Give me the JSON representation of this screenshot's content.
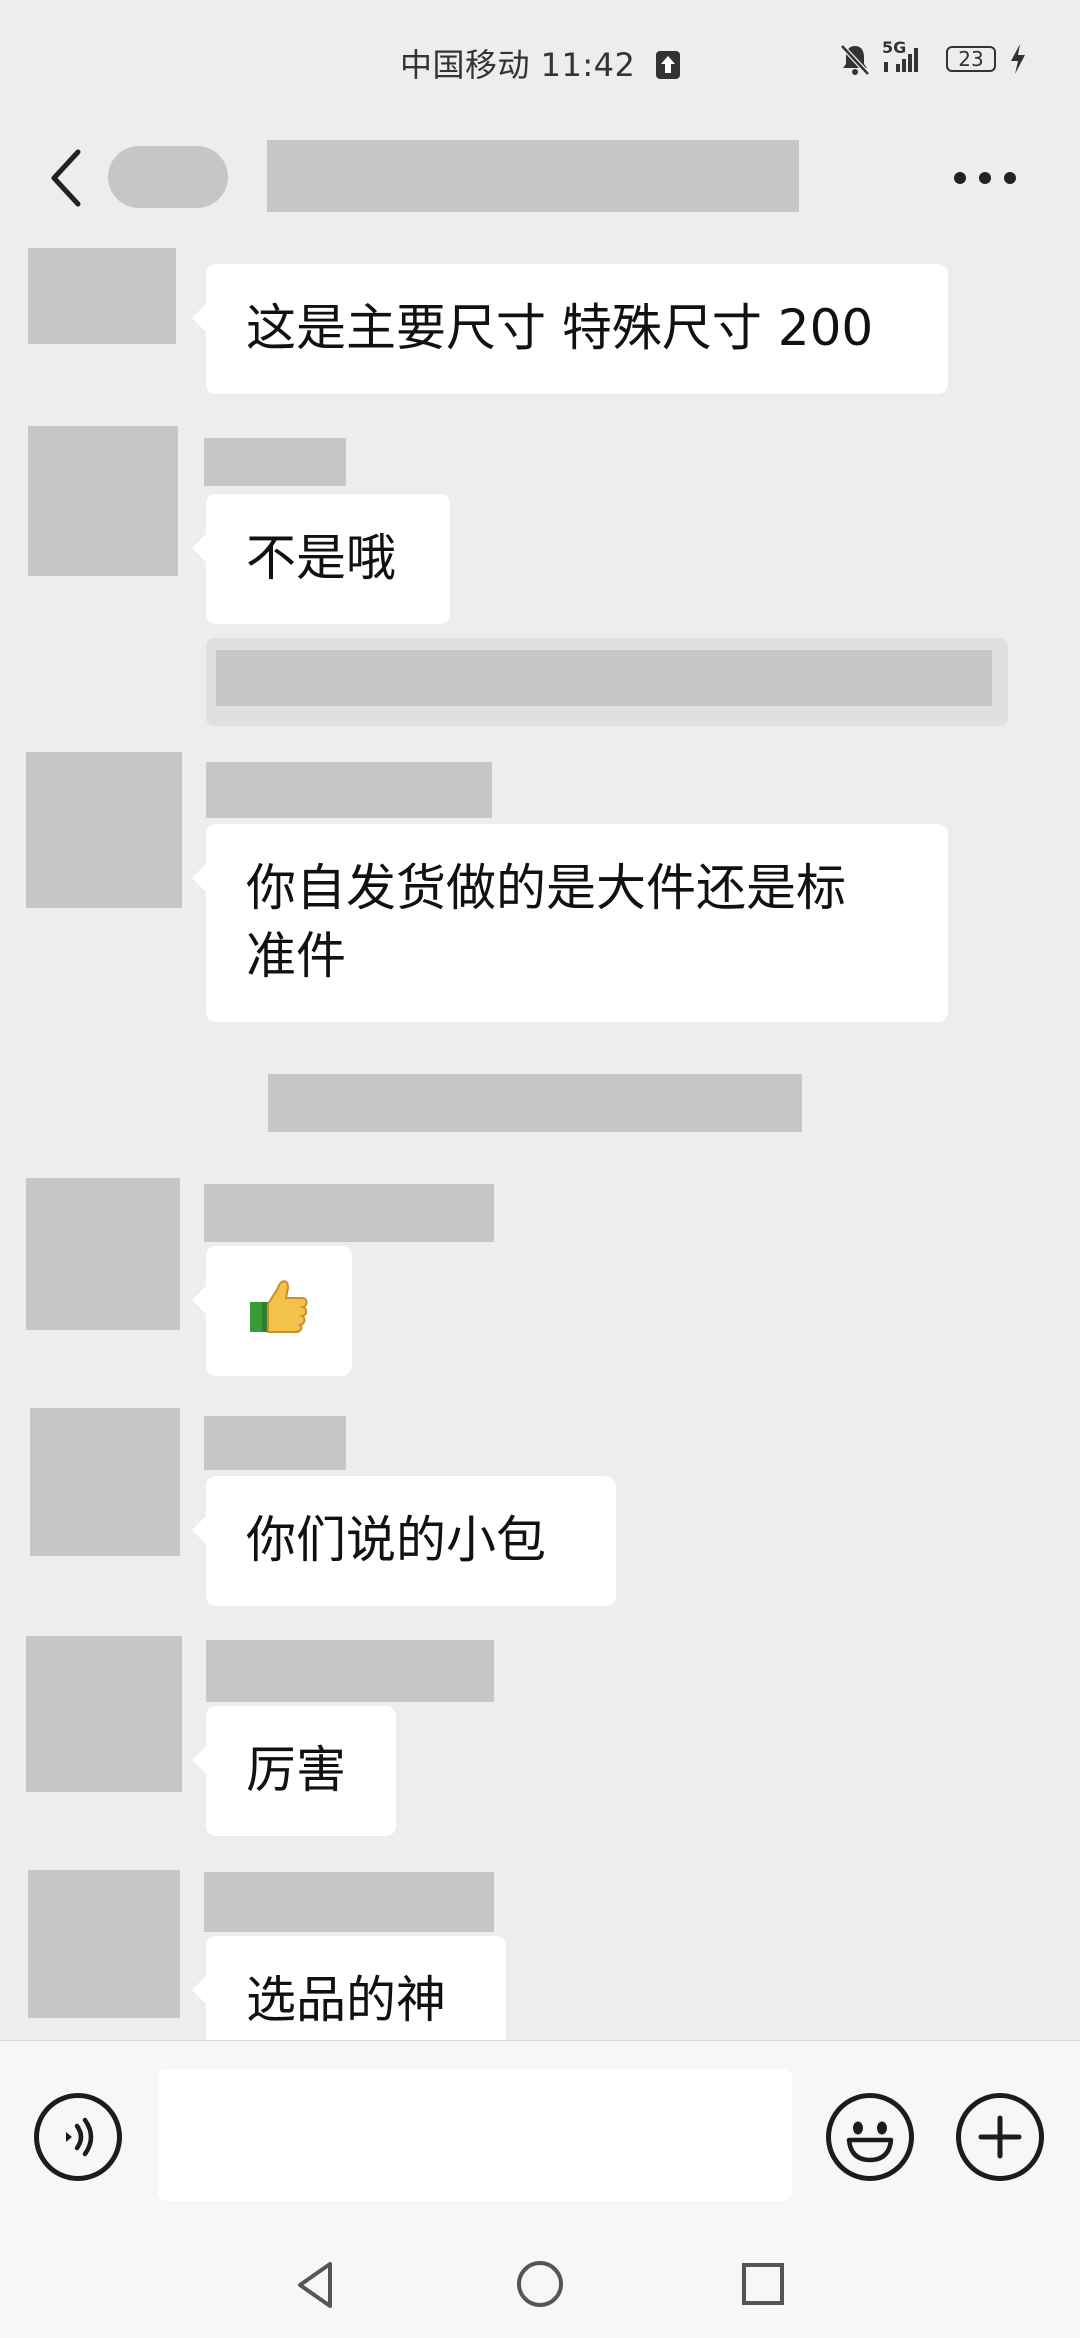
{
  "status_bar": {
    "carrier_time": "中国移动 11:42",
    "network": "5G",
    "battery": "23"
  },
  "messages": [
    {
      "text": "这是主要尺寸 特殊尺寸 200"
    },
    {
      "text": "不是哦"
    },
    {
      "text_line1": "你自发货做的是大件还是标",
      "text_line2": "准件"
    },
    {
      "emoji": "👍"
    },
    {
      "text": "你们说的小包"
    },
    {
      "text": "厉害"
    },
    {
      "text": "选品的神"
    }
  ],
  "icons": {
    "back": "chevron-left-icon",
    "more": "more-dots-icon",
    "voice": "voice-icon",
    "emoji": "smiley-icon",
    "add": "plus-icon",
    "nav_back": "triangle-back-icon",
    "nav_home": "circle-home-icon",
    "nav_recent": "square-recent-icon"
  },
  "colors": {
    "background": "#ededed",
    "bubble": "#ffffff",
    "redaction": "#c6c6c6"
  }
}
